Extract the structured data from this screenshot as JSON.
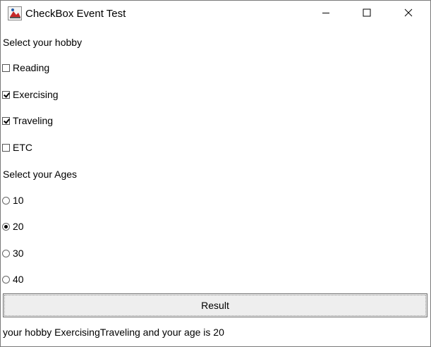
{
  "window": {
    "title": "CheckBox Event Test",
    "icon": "java-app-icon",
    "controls": [
      "minimize-icon",
      "maximize-icon",
      "close-icon"
    ]
  },
  "hobby_section": {
    "label": "Select your hobby",
    "options": [
      {
        "label": "Reading",
        "checked": false
      },
      {
        "label": "Exercising",
        "checked": true
      },
      {
        "label": "Traveling",
        "checked": true
      },
      {
        "label": "ETC",
        "checked": false
      }
    ]
  },
  "age_section": {
    "label": "Select your Ages",
    "options": [
      {
        "label": "10",
        "selected": false
      },
      {
        "label": "20",
        "selected": true
      },
      {
        "label": "30",
        "selected": false
      },
      {
        "label": "40",
        "selected": false
      }
    ]
  },
  "result_button": {
    "label": "Result"
  },
  "status_text": "your hobby ExercisingTraveling and your age is 20"
}
